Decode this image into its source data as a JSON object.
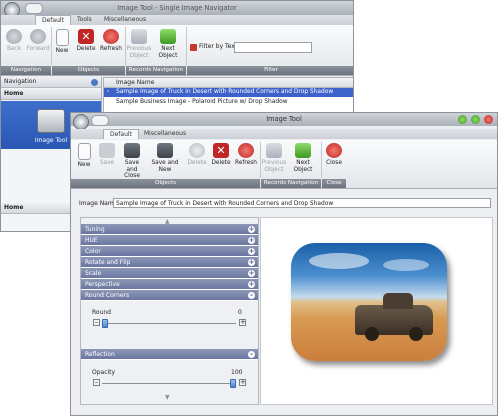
{
  "back_window": {
    "title": "Image Tool - Single Image Navigator",
    "tabs": [
      "Default",
      "Tools",
      "Miscellaneous"
    ],
    "ribbon": {
      "back": "Back",
      "forward": "Forward",
      "new": "New",
      "delete": "Delete",
      "refresh": "Refresh",
      "previous_object": "Previous Object",
      "next_object": "Next Object",
      "filter_by_text": "Filter by Text",
      "groups": [
        "Navigation History",
        "Objects",
        "Records Navigation",
        "Filter"
      ]
    },
    "navigation": {
      "label": "Navigation",
      "home": "Home",
      "item": "Image Tool",
      "home_bottom": "Home"
    },
    "grid": {
      "column": "Image Name",
      "rows": [
        "Sample Image of Truck in Desert with Rounded Corners and Drop Shadow",
        "Sample Business Image - Polaroid Picture w/ Drop Shadow"
      ]
    }
  },
  "front_window": {
    "title": "Image Tool",
    "tabs": [
      "Default",
      "Miscellaneous"
    ],
    "ribbon": {
      "new": "New",
      "save": "Save",
      "save_and_close": "Save and Close",
      "save_and_new": "Save and New",
      "delete_disabled": "Delete",
      "delete": "Delete",
      "refresh": "Refresh",
      "previous_object": "Previous Object",
      "next_object": "Next Object",
      "close": "Close",
      "groups": [
        "Objects",
        "Records Navigation",
        "Close"
      ]
    },
    "image_name_label": "Image Name",
    "image_name_value": "Sample Image of Truck in Desert with Rounded Corners and Drop Shadow",
    "sections": [
      "Tuning",
      "HUE",
      "Color",
      "Rotate and Flip",
      "Scale",
      "Perspective",
      "Round Corners"
    ],
    "round": {
      "label": "Round",
      "min": "0",
      "value": "0",
      "level": 0.0
    },
    "reflection_label": "Reflection",
    "opacity": {
      "label": "Opacity",
      "value": "100",
      "level": 1.0
    }
  },
  "colors": {
    "accordion": "#7480a8",
    "selection": "#3d62c9",
    "close_button": "#d9342b",
    "refresh_button": "#d53a2e",
    "delete_button": "#c22525"
  }
}
